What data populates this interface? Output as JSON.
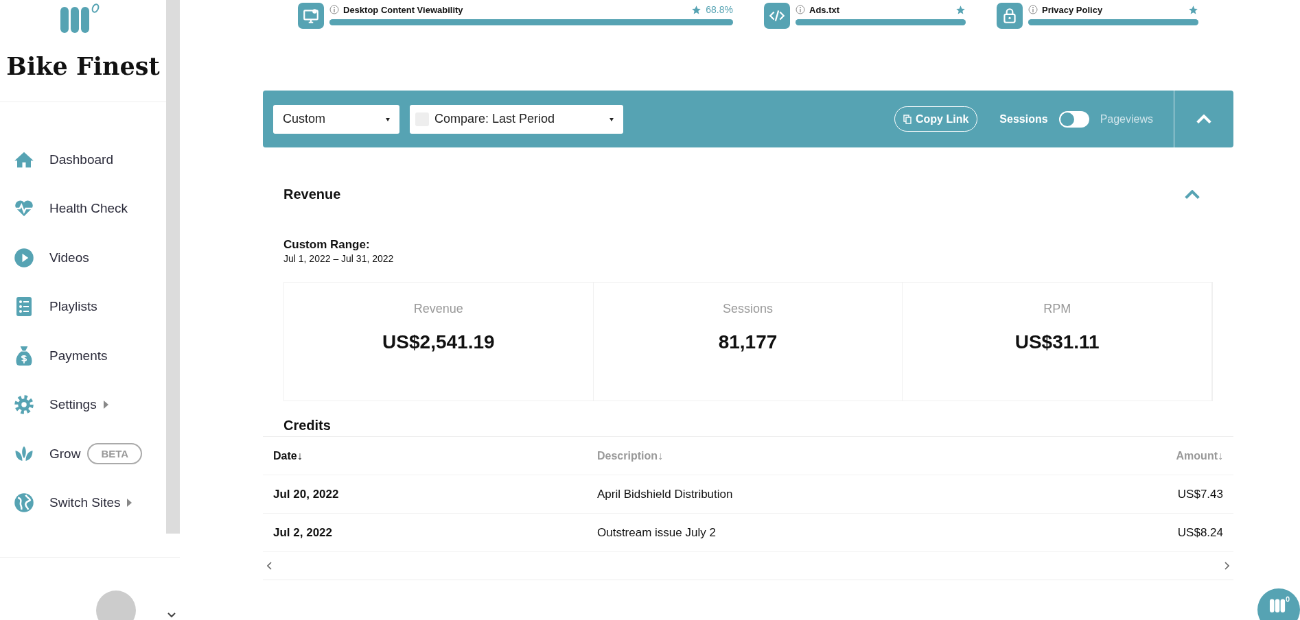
{
  "sidebar": {
    "site_name": "Bike Finest",
    "items": [
      {
        "label": "Dashboard",
        "has_submenu": false
      },
      {
        "label": "Health Check",
        "has_submenu": false
      },
      {
        "label": "Videos",
        "has_submenu": false
      },
      {
        "label": "Playlists",
        "has_submenu": false
      },
      {
        "label": "Payments",
        "has_submenu": false
      },
      {
        "label": "Settings",
        "has_submenu": true
      },
      {
        "label": "Grow",
        "has_submenu": false,
        "badge": "BETA"
      },
      {
        "label": "Switch Sites",
        "has_submenu": true
      }
    ]
  },
  "health_metrics": [
    {
      "label": "Desktop Content Viewability",
      "level": 1,
      "reading": "68.8%"
    },
    {
      "label": "Ads.txt",
      "level": 1
    },
    {
      "label": "Privacy Policy",
      "level": 1
    }
  ],
  "filter_bar": {
    "range": "Custom",
    "compare": "Compare: Last Period",
    "compare_checked": false,
    "copy_link": "Copy Link",
    "toggle": {
      "left_label": "Sessions",
      "right_label": "Pageviews",
      "on": false
    }
  },
  "revenue": {
    "title": "Revenue",
    "range_label": "Custom Range:",
    "range_dates": "Jul 1, 2022 – Jul 31, 2022",
    "stats": [
      {
        "label": "Revenue",
        "value": "US$2,541.19"
      },
      {
        "label": "Sessions",
        "value": "81,177"
      },
      {
        "label": "RPM",
        "value": "US$31.11"
      }
    ]
  },
  "credits": {
    "title": "Credits",
    "columns": [
      {
        "label": "Date↓",
        "sorted": true
      },
      {
        "label": "Description↓",
        "sorted": false
      },
      {
        "label": "Amount↓",
        "sorted": false
      }
    ],
    "rows": [
      [
        "Jul 20, 2022",
        "April Bidshield Distribution",
        "US$7.43"
      ],
      [
        "Jul 2, 2022",
        "Outstream issue July 2",
        "US$8.24"
      ]
    ]
  }
}
